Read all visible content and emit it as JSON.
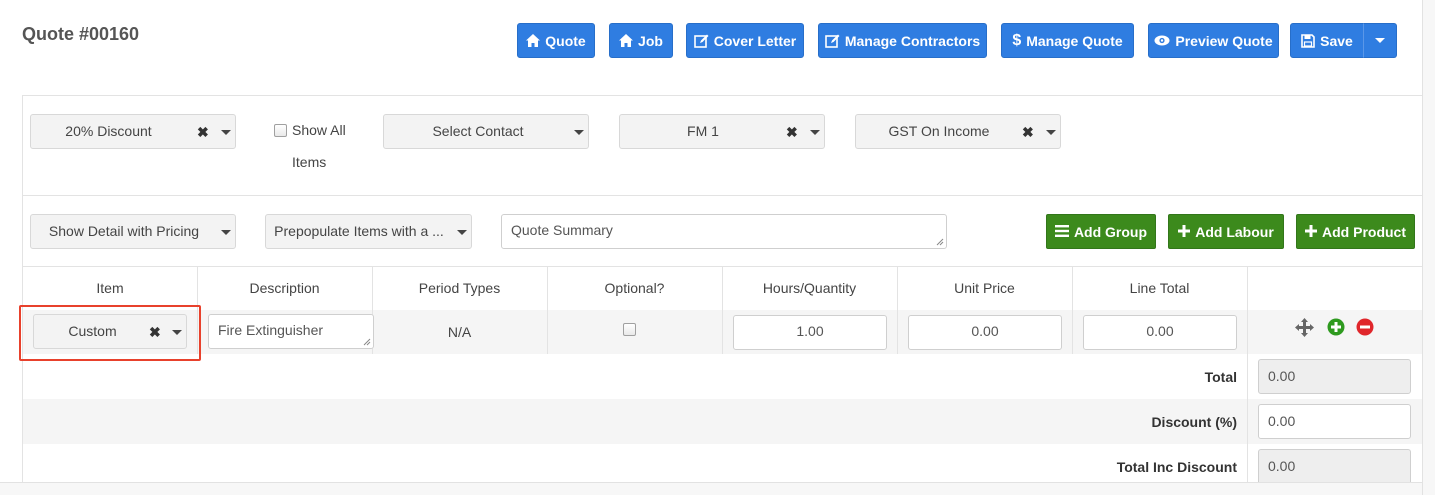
{
  "page_title": "Quote #00160",
  "toolbar": {
    "quote": "Quote",
    "job": "Job",
    "cover_letter": "Cover Letter",
    "manage_contractors": "Manage Contractors",
    "manage_quote": "Manage Quote",
    "preview_quote": "Preview Quote",
    "save": "Save"
  },
  "filters": {
    "discount": "20% Discount",
    "show_all_items_line1": "Show All",
    "show_all_items_line2": "Items",
    "contact_placeholder": "Select Contact",
    "fm": "FM 1",
    "tax": "GST On Income"
  },
  "options": {
    "detail_mode": "Show Detail with Pricing",
    "prepopulate": "Prepopulate Items with a ...",
    "summary_placeholder": "Quote Summary",
    "add_group": "Add Group",
    "add_labour": "Add Labour",
    "add_product": "Add Product"
  },
  "table": {
    "headers": [
      "Item",
      "Description",
      "Period Types",
      "Optional?",
      "Hours/Quantity",
      "Unit Price",
      "Line Total"
    ],
    "rows": [
      {
        "item": "Custom",
        "description": "Fire Extinguisher",
        "period_type": "N/A",
        "optional": false,
        "quantity": "1.00",
        "unit_price": "0.00",
        "line_total": "0.00"
      }
    ]
  },
  "totals": {
    "total_label": "Total",
    "total_value": "0.00",
    "discount_label": "Discount (%)",
    "discount_value": "0.00",
    "total_inc_discount_label": "Total Inc Discount",
    "total_inc_discount_value": "0.00"
  },
  "colors": {
    "primary": "#2f7de1",
    "success": "#3c8a1c",
    "highlight": "#e8412c",
    "add_icon": "#2e9a1f",
    "remove_icon": "#e0262b"
  },
  "icons": [
    "home-icon",
    "edit-icon",
    "dollar-icon",
    "eye-icon",
    "floppy-icon",
    "list-icon",
    "plus-icon",
    "move-icon",
    "plus-circle-icon",
    "minus-circle-icon",
    "clear-x-icon",
    "caret-down-icon"
  ]
}
